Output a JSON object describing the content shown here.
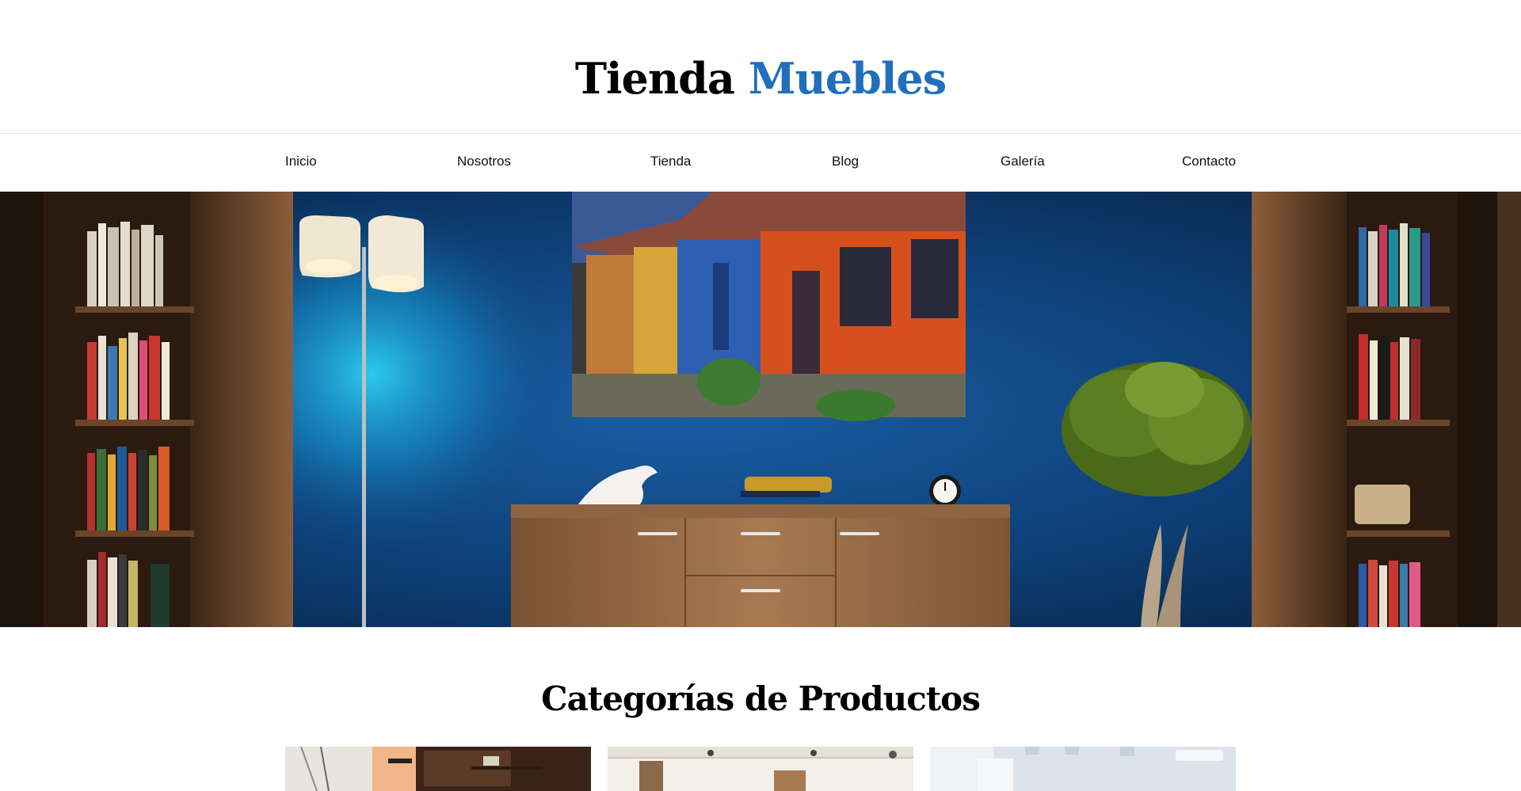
{
  "header": {
    "brand_part1": "Tienda",
    "brand_part2": "Muebles",
    "accent_color": "#1f6fbd"
  },
  "nav": {
    "items": [
      {
        "label": "Inicio"
      },
      {
        "label": "Nosotros"
      },
      {
        "label": "Tienda"
      },
      {
        "label": "Blog"
      },
      {
        "label": "Galería"
      },
      {
        "label": "Contacto"
      }
    ]
  },
  "hero": {
    "scene": "living room with blue wall, bookshelves, floor lamp, painting of colorful houses, wooden sideboard, potted tree"
  },
  "categories": {
    "title": "Categorías de Productos",
    "cards": [
      {
        "theme": "study-desk"
      },
      {
        "theme": "dining-room"
      },
      {
        "theme": "white-room"
      }
    ]
  }
}
